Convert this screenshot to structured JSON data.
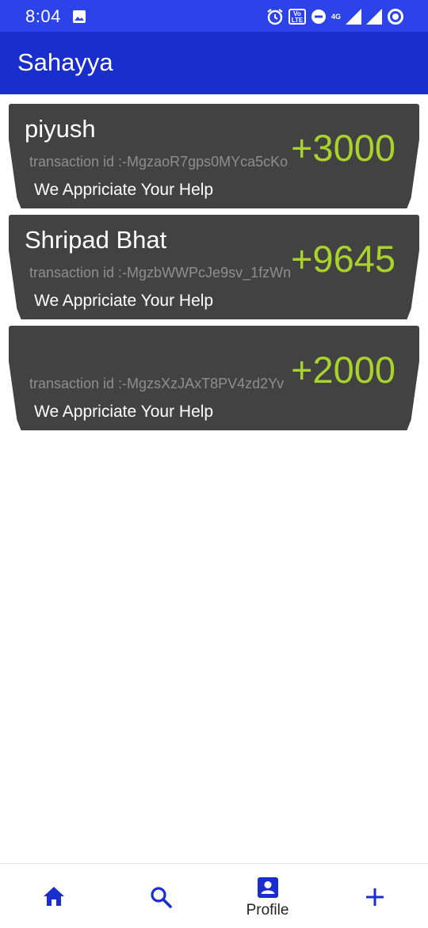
{
  "status_bar": {
    "time": "8:04",
    "volte_label": "Vo LTE",
    "network_label": "4G"
  },
  "app_bar": {
    "title": "Sahayya"
  },
  "colors": {
    "app_bar": "#1a2ece",
    "status_bar": "#2b43e8",
    "card_bg": "#424242",
    "amount": "#a9d22b",
    "nav_icon": "#1a2ece"
  },
  "transactions": [
    {
      "name": "piyush",
      "transaction_id": "transaction id :-MgzaoR7gps0MYca5cKo",
      "amount": "+3000",
      "note": "We Appriciate Your Help"
    },
    {
      "name": "Shripad Bhat",
      "transaction_id": "transaction id :-MgzbWWPcJe9sv_1fzWn",
      "amount": "+9645",
      "note": "We Appriciate Your Help"
    },
    {
      "name": "",
      "transaction_id": "transaction id :-MgzsXzJAxT8PV4zd2Yv",
      "amount": "+2000",
      "note": "We Appriciate Your Help"
    }
  ],
  "bottom_nav": {
    "items": [
      {
        "icon": "home-icon",
        "label": ""
      },
      {
        "icon": "search-icon",
        "label": ""
      },
      {
        "icon": "profile-icon",
        "label": "Profile"
      },
      {
        "icon": "add-icon",
        "label": ""
      }
    ]
  }
}
